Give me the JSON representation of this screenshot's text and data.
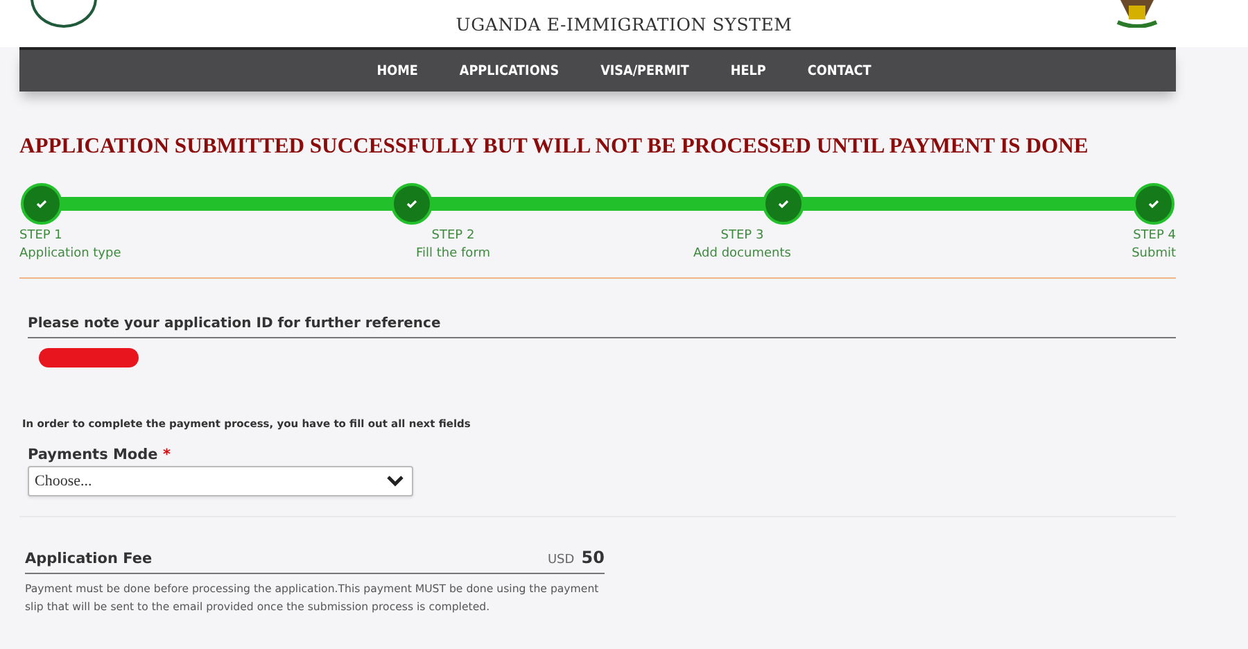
{
  "header": {
    "title": "UGANDA E-IMMIGRATION SYSTEM"
  },
  "nav": [
    {
      "label": "HOME"
    },
    {
      "label": "APPLICATIONS"
    },
    {
      "label": "VISA/PERMIT"
    },
    {
      "label": "HELP"
    },
    {
      "label": "CONTACT"
    }
  ],
  "headline": "APPLICATION SUBMITTED SUCCESSFULLY BUT WILL NOT BE PROCESSED UNTIL PAYMENT IS DONE",
  "steps": [
    {
      "number": "STEP 1",
      "label": "Application type",
      "done": true
    },
    {
      "number": "STEP 2",
      "label": "Fill the form",
      "done": true
    },
    {
      "number": "STEP 3",
      "label": "Add documents",
      "done": true
    },
    {
      "number": "STEP 4",
      "label": "Submit",
      "done": true
    }
  ],
  "application_id": {
    "heading": "Please note your application ID for further reference",
    "redacted": true
  },
  "payment": {
    "intro": "In order to complete the payment process, you have to fill out all next fields",
    "label": "Payments Mode",
    "required_mark": "*",
    "placeholder": "Choose..."
  },
  "fee": {
    "label": "Application Fee",
    "currency": "USD",
    "amount": "50",
    "note": "Payment must be done before processing the application.This payment MUST be done using the payment slip that will be sent to the email provided once the submission process is completed."
  }
}
